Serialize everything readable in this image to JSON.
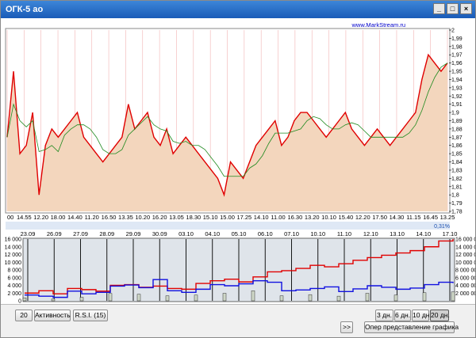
{
  "window": {
    "title": "ОГК-5 ао"
  },
  "header": {
    "site": "www.MarkStream.ru",
    "pct": "0,31%"
  },
  "price_chart": {
    "y_ticks": [
      "2",
      "1,99",
      "1,98",
      "1,97",
      "1,96",
      "1,95",
      "1,94",
      "1,93",
      "1,92",
      "1,91",
      "1,9",
      "1,89",
      "1,88",
      "1,87",
      "1,86",
      "1,85",
      "1,84",
      "1,83",
      "1,82",
      "1,81",
      "1,8",
      "1,79",
      "1,78"
    ],
    "x_ticks": [
      "00",
      "14.55",
      "12.20",
      "18.00",
      "14.40",
      "11.20",
      "16.50",
      "13.35",
      "10.20",
      "16.20",
      "13.05",
      "18.30",
      "15.10",
      "15.00",
      "17.25",
      "14.10",
      "11.00",
      "16.30",
      "13.20",
      "10.10",
      "15.40",
      "12.20",
      "17.50",
      "14.30",
      "11.15",
      "16.45",
      "13.25"
    ]
  },
  "chart_data": [
    {
      "type": "line",
      "title": "",
      "xlabel": "",
      "ylabel": "",
      "ylim": [
        1.78,
        2.0
      ],
      "series": [
        {
          "values": [
            1.87,
            1.95,
            1.85,
            1.86,
            1.9,
            1.8,
            1.86,
            1.88,
            1.87,
            1.88,
            1.89,
            1.9,
            1.87,
            1.86,
            1.85,
            1.84,
            1.85,
            1.86,
            1.87,
            1.91,
            1.88,
            1.89,
            1.9,
            1.87,
            1.86,
            1.88,
            1.85,
            1.86,
            1.87,
            1.86,
            1.85,
            1.84,
            1.83,
            1.82,
            1.8,
            1.84,
            1.83,
            1.82,
            1.84,
            1.86,
            1.87,
            1.88,
            1.89,
            1.86,
            1.87,
            1.89,
            1.9,
            1.9,
            1.89,
            1.88,
            1.87,
            1.88,
            1.89,
            1.9,
            1.88,
            1.87,
            1.86,
            1.87,
            1.88,
            1.87,
            1.86,
            1.87,
            1.88,
            1.89,
            1.9,
            1.94,
            1.97,
            1.96,
            1.95,
            1.96
          ]
        }
      ]
    },
    {
      "type": "line",
      "title": "",
      "xlabel": "",
      "ylabel": "",
      "ylim": [
        0,
        16000
      ],
      "x_ticks": [
        "23.09",
        "26.09",
        "27.09",
        "28.09",
        "29.09",
        "30.09",
        "03.10",
        "04.10",
        "05.10",
        "06.10",
        "07.10",
        "10.10",
        "11.10",
        "12.10",
        "13.10",
        "14.10",
        "17.10"
      ],
      "y_ticks": [
        "16 000",
        "14 000",
        "12 000",
        "10 000",
        "8 000",
        "6 000",
        "4 000",
        "2 000",
        "0"
      ],
      "y2_ticks": [
        "16 000 000",
        "14 000 000",
        "12 000 000",
        "10 000 000",
        "8 000 000",
        "6 000 000",
        "4 000 000",
        "2 000 000"
      ],
      "series": [
        {
          "values": [
            2000,
            2600,
            1800,
            3200,
            2900,
            2500,
            4000,
            4200,
            3500,
            3800,
            3200,
            3000,
            4500,
            5200,
            5600,
            4900,
            6200,
            7500,
            7800,
            8400,
            9200,
            8800,
            9600,
            10500,
            11200,
            11800,
            12400,
            13000,
            14000,
            15500,
            16000
          ]
        },
        {
          "values": [
            1500,
            1200,
            900,
            2500,
            1800,
            2200,
            3800,
            4100,
            3400,
            5500,
            2600,
            2200,
            3000,
            4200,
            3900,
            4400,
            5200,
            4800,
            2600,
            2800,
            3200,
            3600,
            2400,
            3100,
            3900,
            3500,
            3000,
            3300,
            4200,
            4800,
            4600
          ]
        }
      ]
    }
  ],
  "controls": {
    "period_value": "20",
    "activity_label": "Активность",
    "rsi_label": "R.S.I.  (15)",
    "scroll_label": ">>",
    "day_buttons": [
      "3 дн.",
      "6 дн.",
      "10 дн.",
      "20 дн."
    ],
    "active_day": "20 дн.",
    "options_label": "Опер представление графика"
  }
}
